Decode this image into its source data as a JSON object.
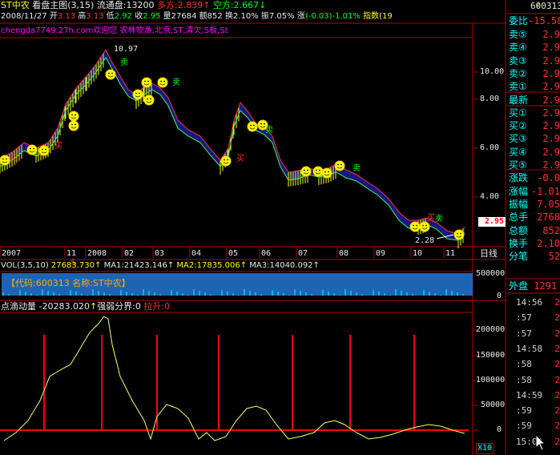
{
  "header": {
    "stock_name": "ST中农",
    "view_label": "看盘主图",
    "params": "(3,15)",
    "float_label": "流通盘:",
    "float_value": "13200",
    "long_label": "多方:",
    "long_value": "2.839",
    "short_label": "空方:",
    "short_value": "2.667",
    "arrow_up": "↑",
    "arrow_down": "↓"
  },
  "quote_line": {
    "date": "2008/11/27",
    "open_label": "开",
    "open": "3.13",
    "high_label": "高",
    "high": "3.13",
    "low_label": "低",
    "low": "2.92",
    "close_label": "收",
    "close": "2.95",
    "vol_label": "量",
    "vol": "27684",
    "amount_label": "额",
    "amount": "852",
    "turnover_label": "换",
    "turnover": "2.10%",
    "amplitude_label": "振",
    "amplitude": "7.05%",
    "change_label": "涨",
    "change": "(-0.03)-1.01%",
    "index_label": "指数(19"
  },
  "ticker_line": "chengda7749.27h.com欢迎您 农林牧渔,北京,ST,清欠,S板,St",
  "price_axis": [
    "10.00",
    "8.00",
    "6.00",
    "4.00"
  ],
  "price_tag": "2.95",
  "price_annotations": {
    "high": "10.97",
    "low": "2.28"
  },
  "signals": {
    "buy": "买",
    "sell": "卖",
    "money_sign": "$"
  },
  "time_axis": [
    "2007",
    "11",
    "2008",
    "02",
    "03",
    "04",
    "05",
    "06",
    "07",
    "08",
    "09",
    "10",
    "11"
  ],
  "day_line_label": "日线",
  "vol_panel": {
    "name": "VOL(3,5,10)",
    "value": "27683.730",
    "ma1": "MA1:21423.146",
    "ma2": "MA2:17835.006",
    "ma3": "MA3:14040.092",
    "info_text": "【代码:600313 名称:ST中农】",
    "axis_top": "500000",
    "axis_zero": "0"
  },
  "osc_panel": {
    "name": "点滴动量",
    "value": "-20283.020",
    "threshold": "强弱分界:0",
    "pull_label": "拉升:0",
    "axis": [
      "200000",
      "150000",
      "100000",
      "50000",
      "0"
    ],
    "scale": "X10"
  },
  "right_panel": {
    "code": "600313",
    "ratio_label": "委比",
    "ratio_value": "-15.58",
    "order_book": [
      {
        "label": "卖⑤",
        "value": "2.9"
      },
      {
        "label": "卖④",
        "value": "2.9"
      },
      {
        "label": "卖③",
        "value": "2.9"
      },
      {
        "label": "卖②",
        "value": "2.9"
      },
      {
        "label": "卖①",
        "value": "2.9"
      },
      {
        "label": "最新",
        "value": "2.9"
      },
      {
        "label": "买①",
        "value": "2.9"
      },
      {
        "label": "买②",
        "value": "2.9"
      },
      {
        "label": "买③",
        "value": "2.9"
      },
      {
        "label": "买④",
        "value": "2.9"
      },
      {
        "label": "买⑤",
        "value": "2.9"
      },
      {
        "label": "涨跌",
        "value": "-0.0"
      },
      {
        "label": "涨幅",
        "value": "-1.01"
      },
      {
        "label": "振幅",
        "value": "7.05"
      },
      {
        "label": "总手",
        "value": "2768"
      },
      {
        "label": "总额",
        "value": "852"
      },
      {
        "label": "换手",
        "value": "2.10"
      },
      {
        "label": "分笔",
        "value": "52"
      }
    ],
    "outer_label": "外盘",
    "outer_value": "1291",
    "ticks": [
      {
        "time": "14:56",
        "val": "2"
      },
      {
        "time": ":57",
        "val": "2"
      },
      {
        "time": ":57",
        "val": "2"
      },
      {
        "time": "14:58",
        "val": "2"
      },
      {
        "time": ":58",
        "val": "2"
      },
      {
        "time": ":58",
        "val": "2"
      },
      {
        "time": "14:59",
        "val": "2"
      },
      {
        "time": ":59",
        "val": "2"
      },
      {
        "time": ":59",
        "val": "2"
      },
      {
        "time": "15:00",
        "val": "2"
      }
    ],
    "scroll_up": "⇧"
  }
}
